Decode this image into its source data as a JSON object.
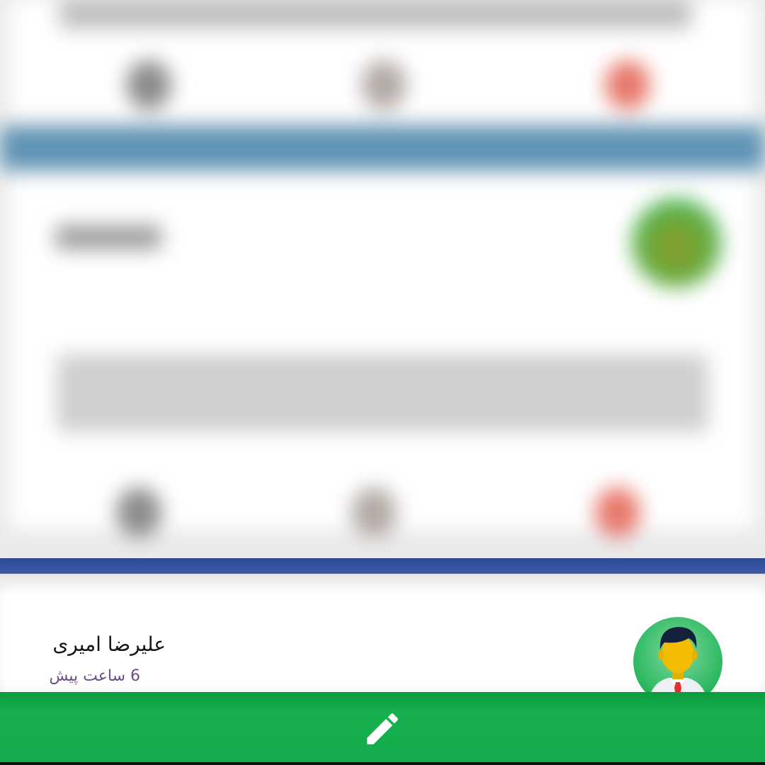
{
  "feed_background": {
    "description": ""
  },
  "post": {
    "author_name": "علیرضا امیری",
    "time_ago": "6 ساعت پیش",
    "avatar_icon": "user-avatar-icon"
  },
  "bottom_bar": {
    "compose_icon": "pencil-icon"
  },
  "colors": {
    "accent_green": "#13ab4b",
    "band_blue": "#3d59a8",
    "time_text": "#6a4f8a"
  }
}
